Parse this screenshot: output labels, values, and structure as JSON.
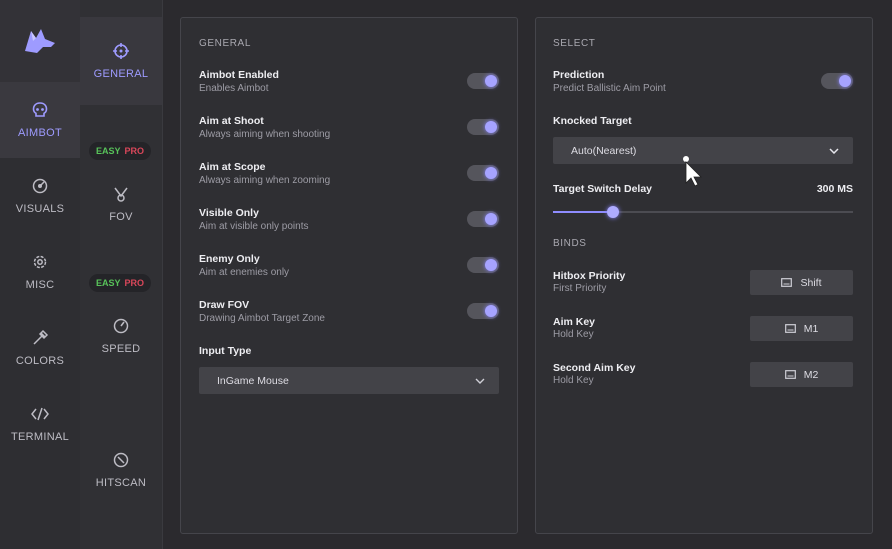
{
  "nav": {
    "items": [
      {
        "label": "AIMBOT",
        "icon": "skull-icon",
        "active": true
      },
      {
        "label": "VISUALS",
        "icon": "eye-icon",
        "active": false
      },
      {
        "label": "MISC",
        "icon": "gear-icon",
        "active": false
      },
      {
        "label": "COLORS",
        "icon": "eyedropper-icon",
        "active": false
      },
      {
        "label": "TERMINAL",
        "icon": "code-icon",
        "active": false
      }
    ]
  },
  "subnav": {
    "items": [
      {
        "label": "GENERAL",
        "icon": "crosshair-icon"
      },
      {
        "label": "FOV",
        "icon": "fov-icon"
      },
      {
        "label": "SPEED",
        "icon": "speedometer-icon"
      },
      {
        "label": "HITSCAN",
        "icon": "hitscan-icon"
      }
    ],
    "badge_easy": "EASY",
    "badge_pro": "PRO"
  },
  "general": {
    "title": "GENERAL",
    "rows": [
      {
        "title": "Aimbot Enabled",
        "sub": "Enables Aimbot",
        "on": true
      },
      {
        "title": "Aim at Shoot",
        "sub": "Always aiming when shooting",
        "on": true
      },
      {
        "title": "Aim at Scope",
        "sub": "Always aiming when zooming",
        "on": true
      },
      {
        "title": "Visible Only",
        "sub": "Aim at visible only points",
        "on": true
      },
      {
        "title": "Enemy Only",
        "sub": "Aim at enemies only",
        "on": true
      },
      {
        "title": "Draw FOV",
        "sub": "Drawing Aimbot Target Zone",
        "on": true
      }
    ],
    "input_type_label": "Input Type",
    "input_type_value": "InGame Mouse"
  },
  "select": {
    "title": "SELECT",
    "prediction_title": "Prediction",
    "prediction_sub": "Predict Ballistic Aim Point",
    "prediction_on": true,
    "knocked_label": "Knocked Target",
    "knocked_value": "Auto(Nearest)",
    "switch_delay_label": "Target Switch Delay",
    "switch_delay_value": "300 MS",
    "switch_delay_fraction": 0.2
  },
  "binds": {
    "title": "BINDS",
    "items": [
      {
        "title": "Hitbox Priority",
        "sub": "First Priority",
        "key": "Shift"
      },
      {
        "title": "Aim Key",
        "sub": "Hold Key",
        "key": "M1"
      },
      {
        "title": "Second Aim Key",
        "sub": "Hold Key",
        "key": "M2"
      }
    ]
  },
  "colors": {
    "accent": "#9e9bff",
    "easy": "#58c35a",
    "pro": "#d9475a"
  }
}
